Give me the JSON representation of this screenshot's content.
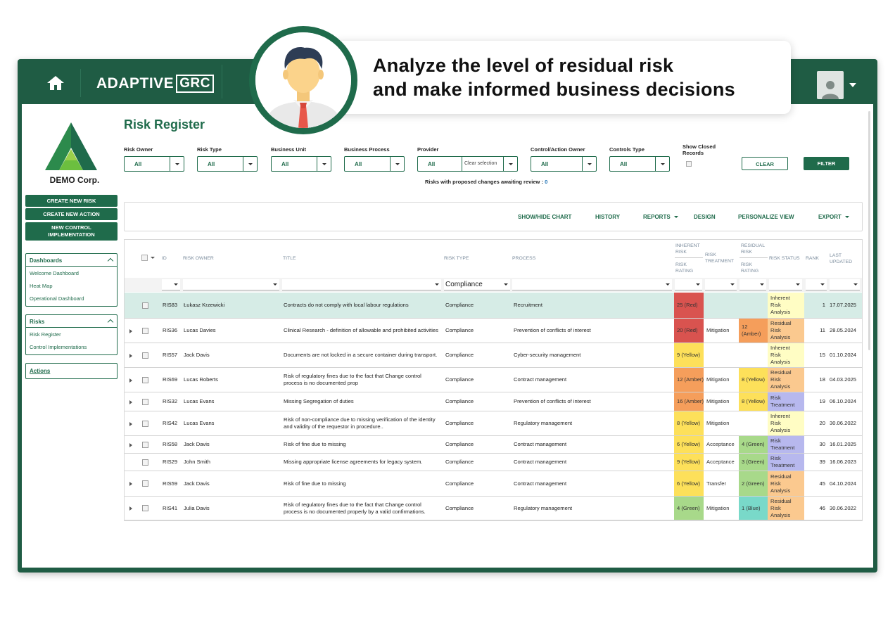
{
  "app": {
    "brand_main": "ADAPTIVE",
    "brand_box": "GRC"
  },
  "callout": {
    "line1": "Analyze the level of residual risk",
    "line2": "and make informed business decisions"
  },
  "sidebar": {
    "company": "DEMO Corp.",
    "buttons": [
      "CREATE NEW RISK",
      "CREATE NEW ACTION",
      "NEW CONTROL IMPLEMENTATION"
    ],
    "dashboards": {
      "title": "Dashboards",
      "items": [
        "Welcome Dashboard",
        "Heat Map",
        "Operational Dashboard"
      ]
    },
    "risks": {
      "title": "Risks",
      "items": [
        "Risk Register",
        "Control Implementations"
      ]
    },
    "actions": "Actions"
  },
  "page": {
    "title": "Risk Register"
  },
  "filters": {
    "risk_owner": {
      "label": "Risk Owner",
      "value": "All"
    },
    "risk_type": {
      "label": "Risk Type",
      "value": "All"
    },
    "business_unit": {
      "label": "Business Unit",
      "value": "All"
    },
    "business_process": {
      "label": "Business Process",
      "value": "All"
    },
    "provider": {
      "label": "Provider",
      "value": "All",
      "clear": "Clear selection"
    },
    "control_owner": {
      "label": "Control/Action Owner",
      "value": "All"
    },
    "controls_type": {
      "label": "Controls Type",
      "value": "All"
    },
    "show_closed": "Show Closed Records",
    "clear": "CLEAR",
    "filter": "FILTER",
    "awaiting": "Risks with proposed changes awaiting review :",
    "awaiting_count": "0"
  },
  "toolbar": {
    "chart": "SHOW/HIDE CHART",
    "history": "HISTORY",
    "reports": "REPORTS",
    "design": "DESIGN",
    "personalize": "PERSONALIZE VIEW",
    "export": "EXPORT"
  },
  "table": {
    "headers": {
      "id": "ID",
      "owner": "RISK OWNER",
      "title": "TITLE",
      "type": "RISK TYPE",
      "process": "PROCESS",
      "inherent_top": "INHERENT RISK",
      "inherent_sub": "RISK RATING",
      "treatment": "RISK TREATMENT",
      "residual_top": "RESIDUAL RISK",
      "residual_sub": "RISK RATING",
      "status": "RISK STATUS",
      "rank": "RANK",
      "updated": "LAST UPDATED"
    },
    "filter_risk_type": "Compliance",
    "colors": {
      "Red": "#d9534f",
      "Amber": "#f59e5b",
      "Yellow": "#fde05a",
      "Green": "#a8d98a",
      "Blue": "#79d9c9",
      "status_inherent": "#fffdc4",
      "status_residual": "#fbc98f",
      "status_treatment": "#b7b8ee",
      "highlight": "#d6ece6"
    },
    "rows": [
      {
        "id": "RIS83",
        "owner": "Łukasz Krzewicki",
        "title": "Contracts do not comply with local labour regulations",
        "type": "Compliance",
        "process": "Recruitment",
        "inherent": "25 (Red)",
        "inherent_c": "Red",
        "treatment": "",
        "residual": "",
        "residual_c": "",
        "status": "Inherent Risk Analysis",
        "status_c": "status_inherent",
        "rank": "1",
        "updated": "17.07.2025",
        "expand": false
      },
      {
        "id": "RIS36",
        "owner": "Lucas Davies",
        "title": "Clinical Research - definition of allowable and prohibited activities",
        "type": "Compliance",
        "process": "Prevention of conflicts of interest",
        "inherent": "20 (Red)",
        "inherent_c": "Red",
        "treatment": "Mitigation",
        "residual": "12 (Amber)",
        "residual_c": "Amber",
        "status": "Residual Risk Analysis",
        "status_c": "status_residual",
        "rank": "11",
        "updated": "28.05.2024",
        "expand": true
      },
      {
        "id": "RIS57",
        "owner": "Jack Davis",
        "title": "Documents are not locked in a secure container during transport.",
        "type": "Compliance",
        "process": "Cyber-security management",
        "inherent": "9 (Yellow)",
        "inherent_c": "Yellow",
        "treatment": "",
        "residual": "",
        "residual_c": "",
        "status": "Inherent Risk Analysis",
        "status_c": "status_inherent",
        "rank": "15",
        "updated": "01.10.2024",
        "expand": true
      },
      {
        "id": "RIS69",
        "owner": "Lucas Roberts",
        "title": "Risk of regulatory fines due to the fact that Change control process is no documented prop",
        "type": "Compliance",
        "process": "Contract management",
        "inherent": "12 (Amber)",
        "inherent_c": "Amber",
        "treatment": "Mitigation",
        "residual": "8 (Yellow)",
        "residual_c": "Yellow",
        "status": "Residual Risk Analysis",
        "status_c": "status_residual",
        "rank": "18",
        "updated": "04.03.2025",
        "expand": true
      },
      {
        "id": "RIS32",
        "owner": "Lucas Evans",
        "title": "Missing Segregation of duties",
        "type": "Compliance",
        "process": "Prevention of conflicts of interest",
        "inherent": "16 (Amber)",
        "inherent_c": "Amber",
        "treatment": "Mitigation",
        "residual": "8 (Yellow)",
        "residual_c": "Yellow",
        "status": "Risk Treatment",
        "status_c": "status_treatment",
        "rank": "19",
        "updated": "06.10.2024",
        "expand": true
      },
      {
        "id": "RIS42",
        "owner": "Lucas Evans",
        "title": "Risk of non-compliance due to missing verification of the identity and validity of the requestor in procedure..",
        "type": "Compliance",
        "process": "Regulatory management",
        "inherent": "8 (Yellow)",
        "inherent_c": "Yellow",
        "treatment": "Mitigation",
        "residual": "",
        "residual_c": "",
        "status": "Inherent Risk Analysis",
        "status_c": "status_inherent",
        "rank": "20",
        "updated": "30.06.2022",
        "expand": true
      },
      {
        "id": "RIS58",
        "owner": "Jack Davis",
        "title": "Risk of fine due to missing",
        "type": "Compliance",
        "process": "Contract management",
        "inherent": "6 (Yellow)",
        "inherent_c": "Yellow",
        "treatment": "Acceptance",
        "residual": "4 (Green)",
        "residual_c": "Green",
        "status": "Risk Treatment",
        "status_c": "status_treatment",
        "rank": "30",
        "updated": "16.01.2025",
        "expand": true
      },
      {
        "id": "RIS29",
        "owner": "John Smith",
        "title": "Missing appropriate license agreements for legacy system.",
        "type": "Compliance",
        "process": "Contract management",
        "inherent": "9 (Yellow)",
        "inherent_c": "Yellow",
        "treatment": "Acceptance",
        "residual": "3 (Green)",
        "residual_c": "Green",
        "status": "Risk Treatment",
        "status_c": "status_treatment",
        "rank": "39",
        "updated": "16.06.2023",
        "expand": false
      },
      {
        "id": "RIS59",
        "owner": "Jack Davis",
        "title": "Risk of fine due to missing",
        "type": "Compliance",
        "process": "Contract management",
        "inherent": "6 (Yellow)",
        "inherent_c": "Yellow",
        "treatment": "Transfer",
        "residual": "2 (Green)",
        "residual_c": "Green",
        "status": "Residual Risk Analysis",
        "status_c": "status_residual",
        "rank": "45",
        "updated": "04.10.2024",
        "expand": true
      },
      {
        "id": "RIS41",
        "owner": "Julia Davis",
        "title": "Risk of regulatory fines due to the fact that Change control process is no documented properly by a valid confirmations.",
        "type": "Compliance",
        "process": "Regulatory management",
        "inherent": "4 (Green)",
        "inherent_c": "Green",
        "treatment": "Mitigation",
        "residual": "1 (Blue)",
        "residual_c": "Blue",
        "status": "Residual Risk Analysis",
        "status_c": "status_residual",
        "rank": "46",
        "updated": "30.06.2022",
        "expand": true
      }
    ]
  }
}
